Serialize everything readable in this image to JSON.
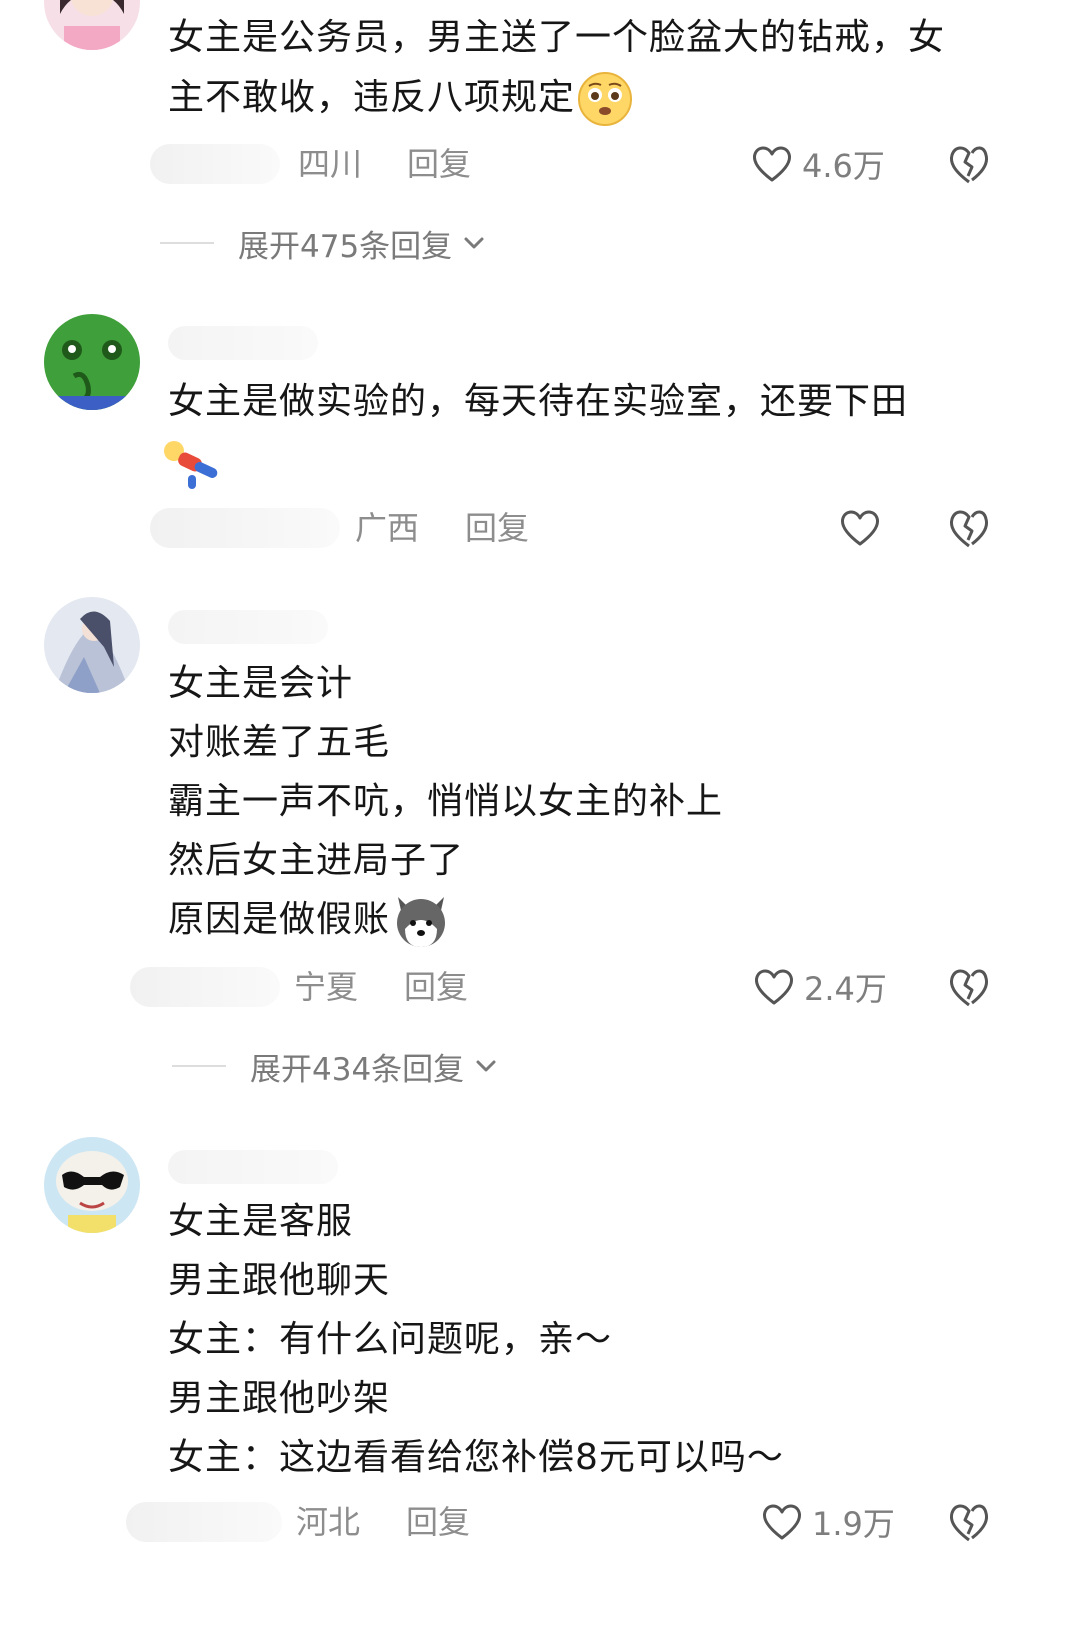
{
  "comments": [
    {
      "text_lines": [
        "女主是公务员，男主送了一个脸盆大的钻戒，女",
        "主不敢收，违反八项规定"
      ],
      "location": "四川",
      "reply_label": "回复",
      "likes": "4.6万",
      "expand_label": "展开475条回复"
    },
    {
      "text_lines": [
        "女主是做实验的，每天待在实验室，还要下田"
      ],
      "location": "广西",
      "reply_label": "回复",
      "likes": ""
    },
    {
      "text_lines": [
        "女主是会计",
        "对账差了五毛",
        "霸主一声不吭，悄悄以女主的补上",
        "然后女主进局子了",
        "原因是做假账"
      ],
      "location": "宁夏",
      "reply_label": "回复",
      "likes": "2.4万",
      "expand_label": "展开434条回复"
    },
    {
      "text_lines": [
        "女主是客服",
        "男主跟他聊天",
        "女主：有什么问题呢，亲～",
        "男主跟他吵架",
        "女主：这边看看给您补偿8元可以吗～"
      ],
      "location": "河北",
      "reply_label": "回复",
      "likes": "1.9万"
    }
  ],
  "icons": {
    "like": "heart-outline-icon",
    "dislike": "broken-heart-icon",
    "expand": "chevron-down-icon",
    "emoji_1": "pleading-face-emoji",
    "emoji_2": "lying-down-person-emoji",
    "emoji_3": "husky-dog-emoji"
  },
  "colors": {
    "text": "#161616",
    "meta_text": "#8d8d8d",
    "divider": "#dddddd",
    "background": "#ffffff"
  }
}
